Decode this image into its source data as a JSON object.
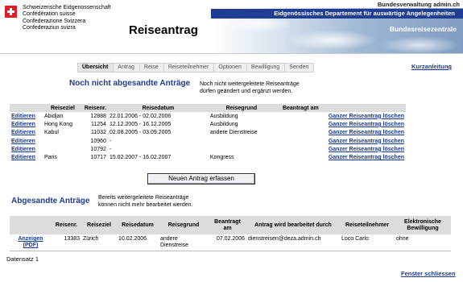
{
  "header": {
    "confederation": [
      "Schweizerische Eidgenossenschaft",
      "Confédération suisse",
      "Confederazione Svizzera",
      "Confederaziun svizra"
    ],
    "app_title": "Reiseantrag",
    "admin_url": "Bundesverwaltung admin.ch",
    "department": "Eidgenössisches Departement für auswärtige Angelegenheiten",
    "app_name": "Bundesreisezentrale",
    "colors": {
      "flag_red": "#e21b23",
      "dept_bar": "#1f3d92"
    }
  },
  "steps": [
    "Übersicht",
    "Antrag",
    "Reise",
    "Reiseteilnehmer",
    "Optionen",
    "Bewilligung",
    "Senden"
  ],
  "active_step": "Übersicht",
  "help_link": "Kurzanleitung",
  "unsent": {
    "title": "Noch nicht abgesandte Anträge",
    "description_line1": "Noch nicht weitergeleitete Reiseanträge",
    "description_line2": "dürfen geändert und ergänzt werden.",
    "columns": [
      "",
      "Reiseziel",
      "Reisenr.",
      "Reisedatum",
      "Reisegrund",
      "Beantragt am",
      ""
    ],
    "rows": [
      {
        "action": "Editieren",
        "destination": "Abidjan",
        "number": "12888",
        "date": "22.01.2006 - 02.02.2006",
        "reason": "Ausbildung",
        "requested": "",
        "delete": "Ganzer Reiseantrag löschen"
      },
      {
        "action": "Editieren",
        "destination": "Hong Kong",
        "number": "11254",
        "date": "12.12.2005 - 16.12.2005",
        "reason": "Ausbildung",
        "requested": "",
        "delete": "Ganzer Reiseantrag löschen"
      },
      {
        "action": "Editieren",
        "destination": "Kabul",
        "number": "11032",
        "date": "02.08.2005 - 03.09.2005",
        "reason": "andere Dienstreise",
        "requested": "",
        "delete": "Ganzer Reiseantrag löschen"
      },
      {
        "action": "Editieren",
        "destination": "",
        "number": "10960",
        "date": "-",
        "reason": "",
        "requested": "",
        "delete": "Ganzer Reiseantrag löschen"
      },
      {
        "action": "Editieren",
        "destination": "",
        "number": "10792",
        "date": "-",
        "reason": "",
        "requested": "",
        "delete": "Ganzer Reiseantrag löschen"
      },
      {
        "action": "Editieren",
        "destination": "Paris",
        "number": "10717",
        "date": "15.02.2007 - 16.02.2007",
        "reason": "Kongress",
        "requested": "",
        "delete": "Ganzer Reiseantrag löschen"
      }
    ],
    "new_button": "Neuen Antrag erfassen"
  },
  "sent": {
    "title": "Abgesandte Anträge",
    "description_line1": "Bereits weitergeleitete Reiseanträge",
    "description_line2": "können nicht mehr bearbeitet werden.",
    "columns": [
      "",
      "Reisenr.",
      "Reiseziel",
      "Reisedatum",
      "Reisegrund",
      "Beantragt am",
      "Antrag wird bearbeitet durch",
      "Reiseteilnehmer",
      "Elektronische Bewilligung"
    ],
    "rows": [
      {
        "action": "Anzeigen (PDF)",
        "number": "13383",
        "destination": "Zürich",
        "date": "10.02.2006",
        "reason": "andere Dienstreise",
        "requested": "07.02.2006",
        "handler": "dienstreisen@deza.admin.ch",
        "participant": "Loco Carlo",
        "approval": "ohne"
      }
    ]
  },
  "record_count": "Datensatz 1",
  "close_link": "Fenster schliessen"
}
